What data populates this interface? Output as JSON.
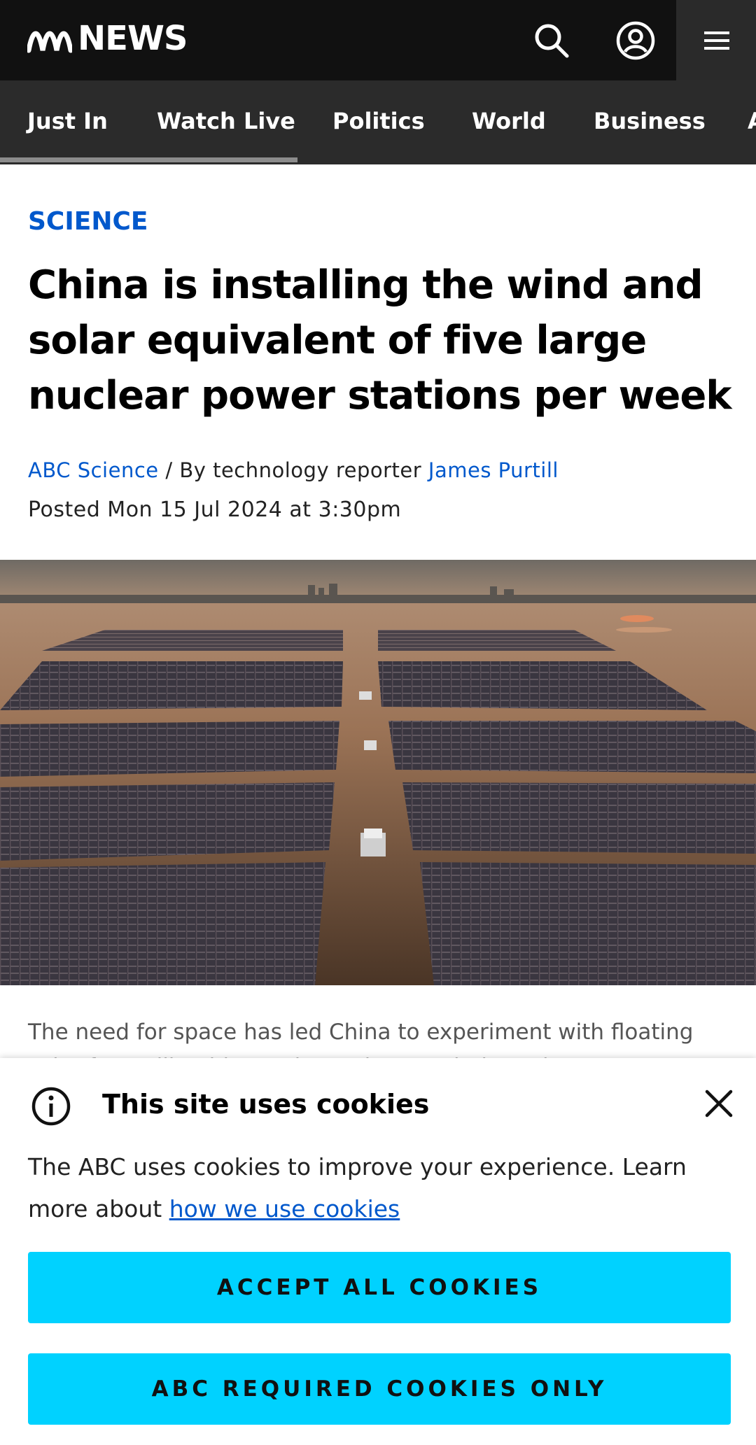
{
  "header": {
    "logo_text": "NEWS",
    "icons": [
      "abc-logo-icon",
      "search-icon",
      "account-icon",
      "menu-icon"
    ]
  },
  "nav": {
    "items": [
      {
        "label": "Just In"
      },
      {
        "label": "Watch Live"
      },
      {
        "label": "Politics"
      },
      {
        "label": "World"
      },
      {
        "label": "Business"
      },
      {
        "label": "A"
      }
    ]
  },
  "article": {
    "category": "SCIENCE",
    "headline": "China is installing the wind and solar equivalent of five large nuclear power stations per week",
    "byline_source": "ABC Science",
    "byline_middle": " / By technology reporter ",
    "byline_author": "James Purtill",
    "posted": "Posted Mon 15 Jul 2024 at 3:30pm",
    "caption": "The need for space has led China to experiment with floating solar farms like this one in Huainan, Anhui province."
  },
  "cookie_banner": {
    "title": "This site uses cookies",
    "text": "The ABC uses cookies to improve your experience. Learn more about ",
    "link": "how we use cookies",
    "accept_label": "ACCEPT ALL COOKIES",
    "required_label": "ABC REQUIRED COOKIES ONLY"
  },
  "colors": {
    "header_bg": "#111111",
    "nav_bg": "#2b2b2b",
    "link_blue": "#0058cc",
    "cookie_button": "#00d2ff"
  }
}
